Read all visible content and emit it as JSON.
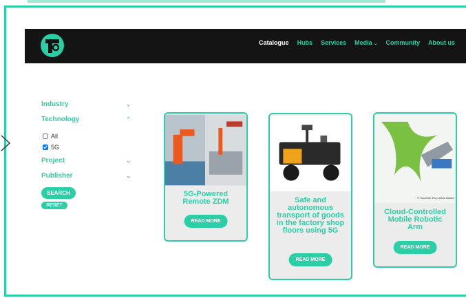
{
  "nav": {
    "items": [
      {
        "label": "Catalogue",
        "active": true
      },
      {
        "label": "Hubs"
      },
      {
        "label": "Services"
      },
      {
        "label": "Media",
        "dropdown": true
      },
      {
        "label": "Community"
      },
      {
        "label": "About us"
      }
    ]
  },
  "filters": {
    "industry": "Industry",
    "technology": "Technology",
    "options": [
      {
        "label": "All",
        "checked": false
      },
      {
        "label": "5G",
        "checked": true
      }
    ],
    "project": "Project",
    "publisher": "Publisher",
    "search_label": "SEARCH",
    "reset_label": "RESET"
  },
  "cards": [
    {
      "title": "5G-Powered Remote ZDM",
      "button": "READ MORE"
    },
    {
      "title": "Safe and autonomous transport of goods in the factory shop floors using 5G",
      "button": "READ MORE"
    },
    {
      "title": "Cloud-Controlled Mobile Robotic Arm",
      "button": "READ MORE",
      "image_caption": "© Fraunhofer IPA | Larissa Klassen"
    }
  ],
  "colors": {
    "accent": "#2bcfa6",
    "header_bg": "#141414",
    "card_bg": "#ececec"
  }
}
